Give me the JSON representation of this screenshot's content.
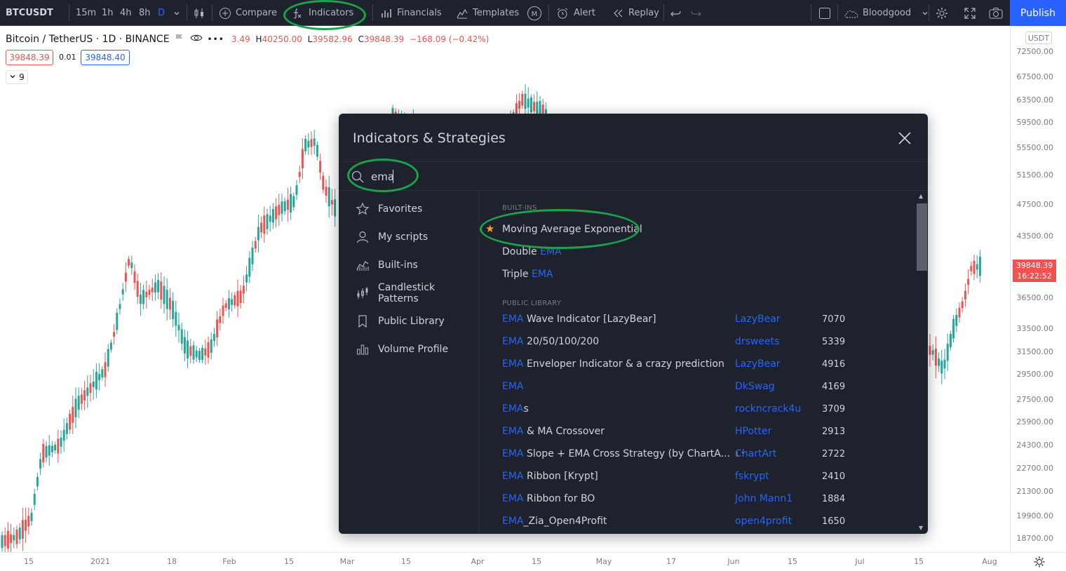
{
  "toolbar": {
    "symbol": "BTCUSDT",
    "timeframes": [
      "15m",
      "1h",
      "4h",
      "8h",
      "D"
    ],
    "compare": "Compare",
    "indicators": "Indicators",
    "financials": "Financials",
    "templates": "Templates",
    "alert": "Alert",
    "replay": "Replay",
    "layout_name": "Bloodgood",
    "publish": "Publish"
  },
  "legend": {
    "title": "Bitcoin / TetherUS · 1D · BINANCE",
    "ohlc_open_value": "3.49",
    "ohlc_high_key": "H",
    "ohlc_high": "40250.00",
    "ohlc_low_key": "L",
    "ohlc_low": "39582.96",
    "ohlc_close_key": "C",
    "ohlc_close": "39848.39",
    "ohlc_change": "−168.09 (−0.42%)",
    "bid": "39848.39",
    "spread": "0.01",
    "ask": "39848.40",
    "indicator_count": "9"
  },
  "price_axis": {
    "currency": "USDT",
    "labels": [
      "72500.00",
      "67500.00",
      "63500.00",
      "59500.00",
      "55500.00",
      "51500.00",
      "47500.00",
      "43500.00",
      "36500.00",
      "33500.00",
      "31500.00",
      "29500.00",
      "27500.00",
      "25900.00",
      "24300.00",
      "22700.00",
      "21300.00",
      "19900.00",
      "18700.00"
    ],
    "last_price": "39848.39",
    "countdown": "16:22:52"
  },
  "time_axis": {
    "labels": [
      "15",
      "2021",
      "18",
      "Feb",
      "15",
      "Mar",
      "15",
      "Apr",
      "15",
      "May",
      "17",
      "Jun",
      "15",
      "Jul",
      "15",
      "Aug"
    ]
  },
  "dialog": {
    "title": "Indicators & Strategies",
    "search_value": "ema",
    "sidebar": [
      "Favorites",
      "My scripts",
      "Built-ins",
      "Candlestick Patterns",
      "Public Library",
      "Volume Profile"
    ],
    "builtins_header": "BUILT-INS",
    "builtins": [
      {
        "pre": "",
        "hit": "",
        "post": "Moving Average Exponential"
      },
      {
        "pre": "Double ",
        "hit": "EMA",
        "post": ""
      },
      {
        "pre": "Triple ",
        "hit": "EMA",
        "post": ""
      }
    ],
    "public_header": "PUBLIC LIBRARY",
    "public": [
      {
        "hit": "EMA",
        "post": " Wave Indicator [LazyBear]",
        "author": "LazyBear",
        "likes": "7070"
      },
      {
        "hit": "EMA",
        "post": " 20/50/100/200",
        "author": "drsweets",
        "likes": "5339"
      },
      {
        "hit": "EMA",
        "post": " Enveloper Indicator & a crazy prediction",
        "author": "LazyBear",
        "likes": "4916"
      },
      {
        "hit": "EMA",
        "post": "",
        "author": "DkSwag",
        "likes": "4169"
      },
      {
        "hit": "EMA",
        "post": "s",
        "author": "rockncrack4u",
        "likes": "3709"
      },
      {
        "hit": "EMA",
        "post": " & MA Crossover",
        "author": "HPotter",
        "likes": "2913"
      },
      {
        "hit": "EMA",
        "post": " Slope + EMA Cross Strategy (by ChartA...",
        "author": "ChartArt",
        "likes": "2722"
      },
      {
        "hit": "EMA",
        "post": " Ribbon [Krypt]",
        "author": "fskrypt",
        "likes": "2410"
      },
      {
        "hit": "EMA",
        "post": " Ribbon for BO",
        "author": "John Mann1",
        "likes": "1884"
      },
      {
        "hit": "EMA",
        "post": "_Zia_Open4Profit",
        "author": "open4profit",
        "likes": "1650"
      }
    ]
  },
  "colors": {
    "up": "#26a69a",
    "down": "#ef5350",
    "accent": "#2962ff",
    "highlight": "#1aa34a",
    "dialog_bg": "#1e222d"
  }
}
